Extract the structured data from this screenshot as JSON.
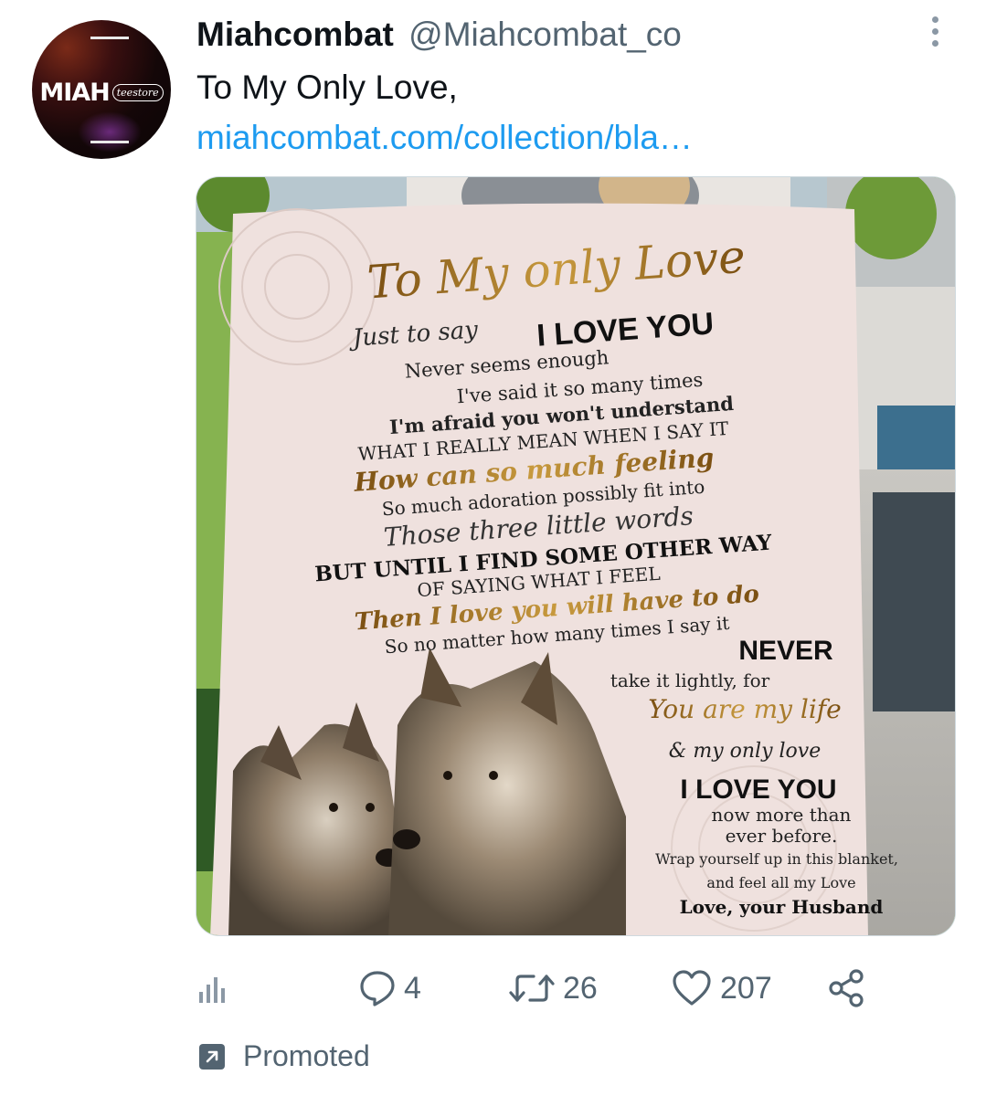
{
  "account": {
    "display_name": "Miahcombat",
    "handle": "@Miahcombat_co",
    "avatar_logo_main": "MIAH",
    "avatar_logo_sub": "teestore"
  },
  "tweet": {
    "text": "To My Only Love,",
    "link": "miahcombat.com/collection/bla…"
  },
  "media": {
    "blanket_lines": [
      "To My only Love",
      "Just to say",
      "I LOVE YOU",
      "Never seems enough",
      "I've said it so many times",
      "I'm afraid you won't understand",
      "WHAT I REALLY MEAN WHEN I SAY IT",
      "How can so much feeling",
      "So much adoration possibly fit into",
      "Those three little words",
      "BUT UNTIL I FIND SOME OTHER WAY",
      "OF SAYING WHAT I FEEL",
      "Then I love you will have to do",
      "So no matter how many times I say it",
      "NEVER",
      "take it lightly, for",
      "You are my life",
      "& my only love",
      "I LOVE YOU",
      "now more than",
      "ever before.",
      "Wrap yourself up in this blanket,",
      "and feel all my Love",
      "Love, your Husband"
    ]
  },
  "actions": {
    "analytics_icon": "bar-chart-icon",
    "reply_icon": "speech-bubble-icon",
    "reply_count": "4",
    "retweet_icon": "retweet-arrows-icon",
    "retweet_count": "26",
    "like_icon": "heart-icon",
    "like_count": "207",
    "share_icon": "share-nodes-icon"
  },
  "promoted": {
    "icon": "promoted-arrow-icon",
    "label": "Promoted"
  },
  "colors": {
    "text_primary": "#0f1419",
    "text_secondary": "#536471",
    "link": "#1d9bf0",
    "blanket": "#efe1de",
    "gold": "#9a6a1c"
  }
}
